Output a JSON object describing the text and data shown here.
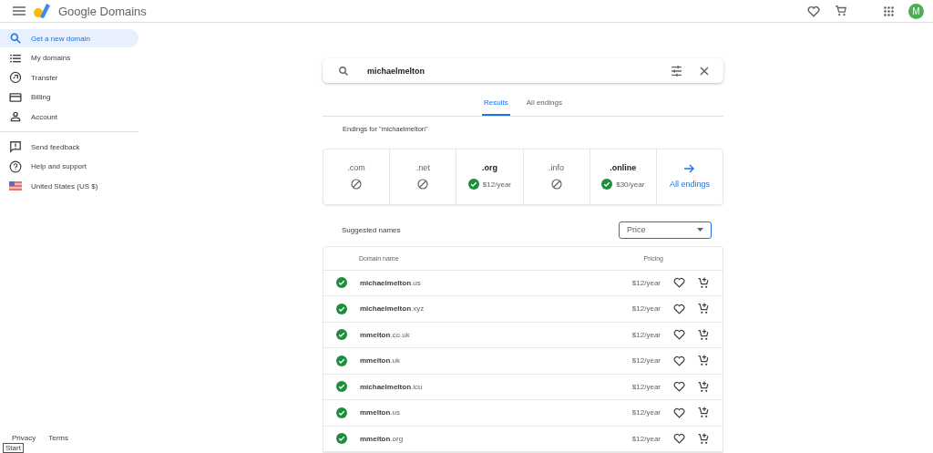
{
  "header": {
    "product": "Google Domains",
    "avatar": "M"
  },
  "sidebar": {
    "items": [
      {
        "label": "Get a new domain",
        "kind": "search",
        "selected": true
      },
      {
        "label": "My domains",
        "kind": "list",
        "selected": false
      },
      {
        "label": "Transfer",
        "kind": "transfer",
        "selected": false
      },
      {
        "label": "Billing",
        "kind": "card",
        "selected": false
      },
      {
        "label": "Account",
        "kind": "person",
        "selected": false
      }
    ],
    "secondary": [
      {
        "label": "Send feedback",
        "kind": "feedback"
      },
      {
        "label": "Help and support",
        "kind": "help"
      },
      {
        "label": "United States (US $)",
        "kind": "flag"
      }
    ],
    "footer": [
      "Privacy",
      "Terms"
    ],
    "tooltip": "Start"
  },
  "search": {
    "value": "michaelmelton"
  },
  "tabs": [
    {
      "label": "Results",
      "selected": true
    },
    {
      "label": "All endings",
      "selected": false
    }
  ],
  "endings_title": "Endings for \"michaelmelton\"",
  "endings": [
    {
      "name": ".com",
      "available": false
    },
    {
      "name": ".net",
      "available": false
    },
    {
      "name": ".org",
      "available": true,
      "price": "$12/year"
    },
    {
      "name": ".info",
      "available": false
    },
    {
      "name": ".online",
      "available": true,
      "price": "$30/year"
    }
  ],
  "all_endings_link": "All endings",
  "suggested": {
    "title": "Suggested names",
    "sort": "Price",
    "columns": [
      "Domain name",
      "Pricing"
    ],
    "rows": [
      {
        "name": "**michaelmelton**.us",
        "price": "$12/year"
      },
      {
        "name": "**michaelmelton**.xyz",
        "price": "$12/year"
      },
      {
        "name": "**mmelton**.co.uk",
        "price": "$12/year"
      },
      {
        "name": "**mmelton**.uk",
        "price": "$12/year"
      },
      {
        "name": "**michaelmelton**.icu",
        "price": "$12/year"
      },
      {
        "name": "**mmelton**.us",
        "price": "$12/year"
      },
      {
        "name": "**mmelton**.org",
        "price": "$12/year"
      }
    ]
  }
}
